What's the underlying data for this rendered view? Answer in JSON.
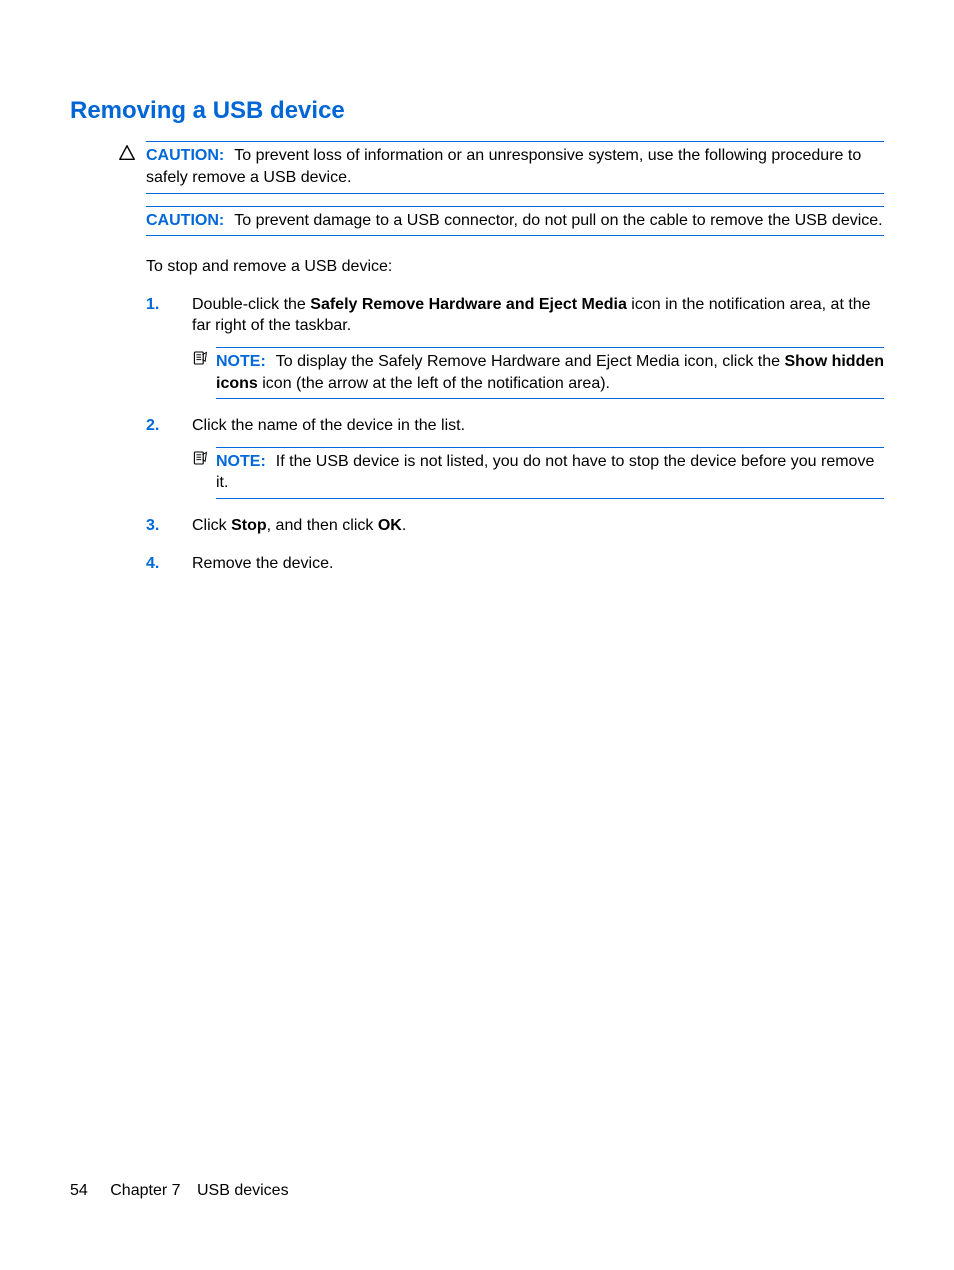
{
  "title": "Removing a USB device",
  "caution1": {
    "label": "CAUTION:",
    "text": "To prevent loss of information or an unresponsive system, use the following procedure to safely remove a USB device."
  },
  "caution2": {
    "label": "CAUTION:",
    "text": "To prevent damage to a USB connector, do not pull on the cable to remove the USB device."
  },
  "intro": "To stop and remove a USB device:",
  "steps": {
    "s1": {
      "num": "1.",
      "pre": "Double-click the ",
      "bold": "Safely Remove Hardware and Eject Media",
      "post": " icon in the notification area, at the far right of the taskbar."
    },
    "note1": {
      "label": "NOTE:",
      "pre": "To display the Safely Remove Hardware and Eject Media icon, click the ",
      "bold": "Show hidden icons",
      "post": " icon (the arrow at the left of the notification area)."
    },
    "s2": {
      "num": "2.",
      "text": "Click the name of the device in the list."
    },
    "note2": {
      "label": "NOTE:",
      "text": "If the USB device is not listed, you do not have to stop the device before you remove it."
    },
    "s3": {
      "num": "3.",
      "pre": "Click ",
      "b1": "Stop",
      "mid": ", and then click ",
      "b2": "OK",
      "post": "."
    },
    "s4": {
      "num": "4.",
      "text": "Remove the device."
    }
  },
  "footer": {
    "page": "54",
    "chapter": "Chapter 7",
    "section": "USB devices"
  }
}
